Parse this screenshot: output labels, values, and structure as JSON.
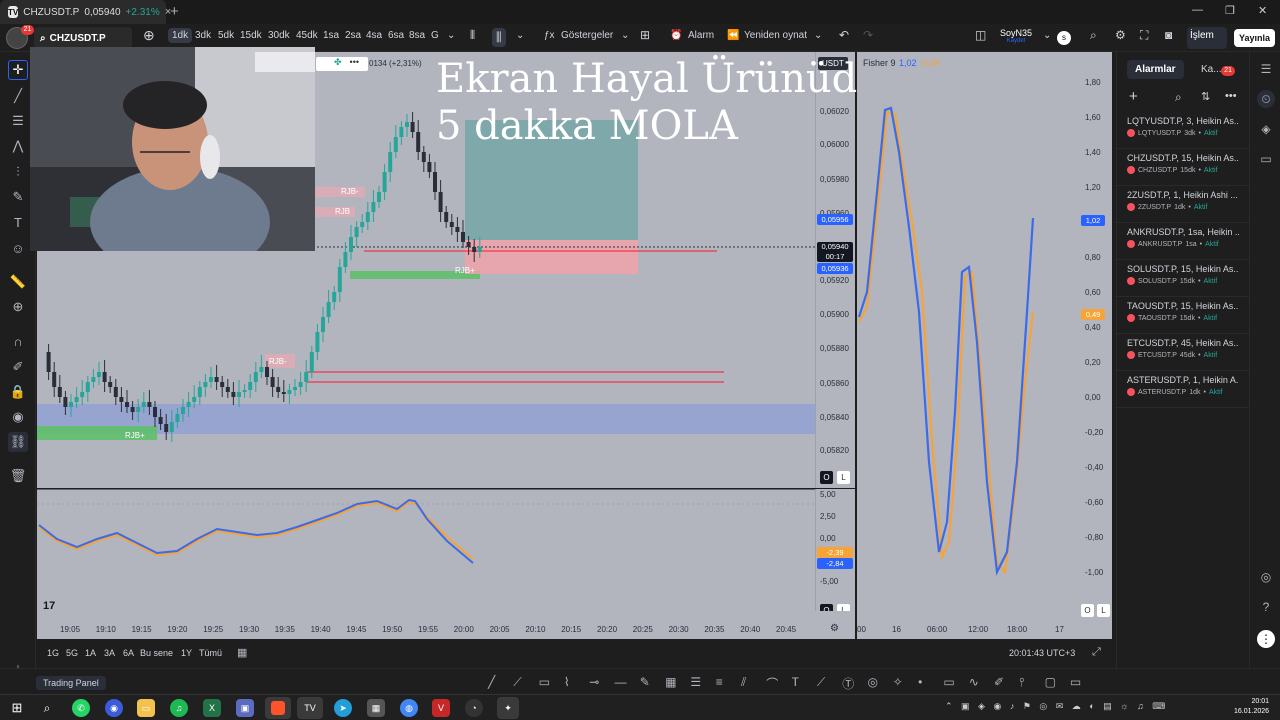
{
  "browser": {
    "tab_title": "CHZUSDT.P",
    "tab_price": "0,05940",
    "tab_change": "+2.31%",
    "tab_close": "×",
    "new_tab": "+",
    "window_controls": [
      "—",
      "❐",
      "✕"
    ]
  },
  "toolbar": {
    "avatar_badge": "21",
    "symbol": "CHZUSDT.P",
    "timeframes": [
      "1dk",
      "3dk",
      "5dk",
      "15dk",
      "30dk",
      "45dk",
      "1sa",
      "2sa",
      "4sa",
      "6sa",
      "8sa",
      "G"
    ],
    "active_timeframe": "1dk",
    "indicators_label": "Göstergeler",
    "alarm_label": "Alarm",
    "replay_label": "Yeniden oynat",
    "layout_name": "SoyN35",
    "layout_sub": "Kaydet",
    "layout_badge": "s",
    "trade_label": "İşlem",
    "publish_label": "Yayınla"
  },
  "chart": {
    "change_readout": "0134 (+2,31%)",
    "symbol_chip": "USDT",
    "price_labels": [
      "0,06020",
      "0,06000",
      "0,05980",
      "0,05960",
      "0,05920",
      "0,05900",
      "0,05880",
      "0,05860",
      "0,05840",
      "0,05820"
    ],
    "badge_top": "0,05956",
    "badge_current": "0,05940",
    "badge_countdown": "00:17",
    "badge_low": "0,05936",
    "zone_labels": [
      "RJB-",
      "RJB",
      "RJB-",
      "RJB+",
      "RJB+"
    ],
    "osc_labels": [
      "5,00",
      "2,50",
      "0,00",
      "-5,00"
    ],
    "osc_badge1": "-2,39",
    "osc_badge2": "-2,84",
    "pane_btn_o": "O",
    "pane_btn_l": "L",
    "tv_logo": "17",
    "time_labels": [
      "19:05",
      "19:10",
      "19:15",
      "19:20",
      "19:25",
      "19:30",
      "19:35",
      "19:40",
      "19:45",
      "19:50",
      "19:55",
      "20:00",
      "20:05",
      "20:10",
      "20:15",
      "20:20",
      "20:25",
      "20:30",
      "20:35",
      "20:40",
      "20:45"
    ],
    "colors": {
      "up": "#26a69a",
      "down": "#2a2e39",
      "red_line": "#f23645",
      "zone_blue": "#8f9fd6",
      "zone_green": "#5fbf6a",
      "osc_blue": "#3d6be8",
      "osc_orange": "#f7a336"
    }
  },
  "fisher": {
    "title": "Fisher 9",
    "value1": "1,02",
    "value2": "0,49",
    "axis_labels": [
      "1,80",
      "1,60",
      "1,40",
      "1,20",
      "1,00",
      "0,80",
      "0,60",
      "0,40",
      "0,20",
      "0,00",
      "-0,20",
      "-0,40",
      "-0,60",
      "-0,80",
      "-1,00"
    ],
    "badge1": "1,02",
    "badge2": "0,49",
    "time_labels": [
      "00",
      "16",
      "06:00",
      "12:00",
      "18:00",
      "17"
    ]
  },
  "overlay": {
    "line1": "Ekran Hayal Ürünüdür",
    "line2": "5 dakka MOLA"
  },
  "sidebar": {
    "tab_alarms": "Alarmlar",
    "tab_other": "Ka...",
    "badge": "21",
    "alerts": [
      {
        "title": "LQTYUSDT.P, 3, Heikin As...",
        "symbol": "LQTYUSDT.P",
        "tf": "3dk",
        "status": "Aktif"
      },
      {
        "title": "CHZUSDT.P, 15, Heikin As...",
        "symbol": "CHZUSDT.P",
        "tf": "15dk",
        "status": "Aktif"
      },
      {
        "title": "2ZUSDT.P, 1, Heikin Ashi ...",
        "symbol": "2ZUSDT.P",
        "tf": "1dk",
        "status": "Aktif"
      },
      {
        "title": "ANKRUSDT.P, 1sa, Heikin ...",
        "symbol": "ANKRUSDT.P",
        "tf": "1sa",
        "status": "Aktif"
      },
      {
        "title": "SOLUSDT.P, 15, Heikin As...",
        "symbol": "SOLUSDT.P",
        "tf": "15dk",
        "status": "Aktif"
      },
      {
        "title": "TAOUSDT.P, 15, Heikin As...",
        "symbol": "TAOUSDT.P",
        "tf": "15dk",
        "status": "Aktif"
      },
      {
        "title": "ETCUSDT.P, 45, Heikin As...",
        "symbol": "ETCUSDT.P",
        "tf": "45dk",
        "status": "Aktif"
      },
      {
        "title": "ASTERUSDT.P, 1, Heikin A...",
        "symbol": "ASTERUSDT.P",
        "tf": "1dk",
        "status": "Aktif"
      }
    ]
  },
  "bottom": {
    "ranges": [
      "1G",
      "5G",
      "1A",
      "3A",
      "6A",
      "Bu sene",
      "1Y",
      "Tümü"
    ],
    "clock": "20:01:43 UTC+3",
    "trading_panel": "Trading Panel"
  },
  "taskbar": {
    "time": "20:01",
    "date": "16.01.2026"
  }
}
